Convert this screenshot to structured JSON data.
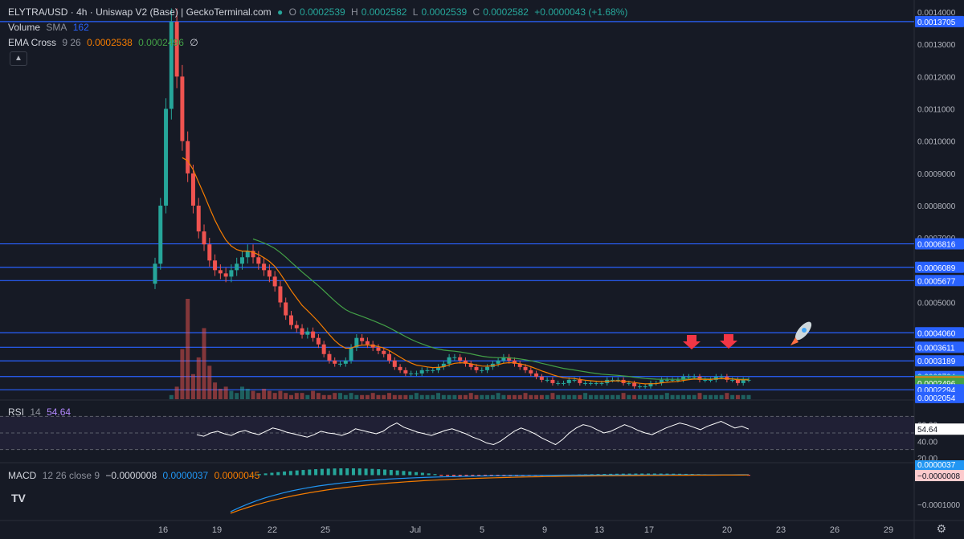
{
  "header": {
    "title": "ELYTRA/USD · 4h · Uniswap V2 (Base) | GeckoTerminal.com",
    "o_label": "O",
    "o_value": "0.0002539",
    "h_label": "H",
    "h_value": "0.0002582",
    "l_label": "L",
    "l_value": "0.0002539",
    "c_label": "C",
    "c_value": "0.0002582",
    "change": "+0.0000043 (+1.68%)"
  },
  "volume_legend": {
    "label": "Volume",
    "sma_label": "SMA",
    "sma_value": "162"
  },
  "ema_legend": {
    "label": "EMA Cross",
    "params": "9 26",
    "ema9": "0.0002538",
    "ema26": "0.0002496",
    "symbol": "∅"
  },
  "rsi_legend": {
    "label": "RSI",
    "param": "14",
    "value": "54.64"
  },
  "macd_legend": {
    "label": "MACD",
    "params": "12 26 close 9",
    "macd": "−0.0000008",
    "signal": "0.0000037",
    "hist": "0.0000045"
  },
  "colors": {
    "up": "#26a69a",
    "down": "#ef5350",
    "ema9": "#f57c00",
    "ema26": "#43a047",
    "hline": "#2962ff",
    "bg": "#161a25"
  },
  "chart_data": {
    "type": "candlestick",
    "title": "ELYTRA/USD · 4h · Uniswap V2 (Base)",
    "x_tick_labels": [
      "16",
      "19",
      "22",
      "25",
      "Jul",
      "5",
      "9",
      "13",
      "17",
      "20",
      "23",
      "26",
      "29"
    ],
    "price_ticks": [
      "0.0014000",
      "0.0013000",
      "0.0012000",
      "0.0011000",
      "0.0010000",
      "0.0009000",
      "0.0008000",
      "0.0007000",
      "0.0005000"
    ],
    "price_ylim": [
      0.0002,
      0.0014
    ],
    "horizontal_lines": [
      0.0013705,
      0.0006816,
      0.0006089,
      0.0005677,
      0.000406,
      0.0003611,
      0.0003189,
      0.0002704,
      0.0002294
    ],
    "price_labels": [
      {
        "text": "0.0013705",
        "value": 0.0013705,
        "color": "#2962ff"
      },
      {
        "text": "0.0006816",
        "value": 0.0006816,
        "color": "#2962ff"
      },
      {
        "text": "0.0006089",
        "value": 0.0006089,
        "color": "#2962ff"
      },
      {
        "text": "0.0005677",
        "value": 0.0005677,
        "color": "#2962ff"
      },
      {
        "text": "0.0004060",
        "value": 0.000406,
        "color": "#2962ff"
      },
      {
        "text": "0.0003611",
        "value": 0.0003611,
        "color": "#2962ff"
      },
      {
        "text": "0.0003189",
        "value": 0.0003189,
        "color": "#2962ff"
      },
      {
        "text": "0.0002704",
        "value": 0.0002704,
        "color": "#2962ff"
      },
      {
        "text": "0.0002582",
        "value": 0.0002582,
        "color": "#26a69a"
      },
      {
        "text": "0.0002538",
        "value": 0.0002538,
        "color": "#f57c00"
      },
      {
        "text": "0.0002496",
        "value": 0.0002496,
        "color": "#43a047"
      },
      {
        "text": "0.0002294",
        "value": 0.0002294,
        "color": "#2962ff"
      },
      {
        "text": "0.0002054",
        "value": 0.0002054,
        "color": "#2962ff"
      }
    ],
    "close_series": [
      0.00062,
      0.0008,
      0.0011,
      0.00137,
      0.0012,
      0.001,
      0.0009,
      0.0008,
      0.00072,
      0.00068,
      0.00063,
      0.0006,
      0.00059,
      0.00058,
      0.0006,
      0.00062,
      0.00064,
      0.00066,
      0.00064,
      0.00062,
      0.0006,
      0.00058,
      0.00055,
      0.0005,
      0.00046,
      0.00043,
      0.00042,
      0.0004,
      0.00041,
      0.00039,
      0.00037,
      0.00034,
      0.00032,
      0.00031,
      0.00031,
      0.00032,
      0.00036,
      0.00039,
      0.00038,
      0.00037,
      0.00036,
      0.00035,
      0.00034,
      0.00032,
      0.0003,
      0.00029,
      0.00028,
      0.00028,
      0.00028,
      0.00029,
      0.00029,
      0.00029,
      0.0003,
      0.00031,
      0.00033,
      0.00033,
      0.00032,
      0.00031,
      0.0003,
      0.00029,
      0.00029,
      0.0003,
      0.00031,
      0.00032,
      0.00033,
      0.00032,
      0.00031,
      0.0003,
      0.00029,
      0.00028,
      0.00027,
      0.00026,
      0.00026,
      0.00025,
      0.00025,
      0.00025,
      0.00026,
      0.00026,
      0.00025,
      0.00025,
      0.00025,
      0.00025,
      0.00025,
      0.00026,
      0.00026,
      0.00026,
      0.00025,
      0.00025,
      0.00024,
      0.00024,
      0.00024,
      0.00025,
      0.00025,
      0.00026,
      0.00026,
      0.00026,
      0.00026,
      0.00027,
      0.00027,
      0.00027,
      0.00026,
      0.00026,
      0.00026,
      0.00027,
      0.00027,
      0.00026,
      0.00026,
      0.00025,
      0.00026,
      0.00026
    ],
    "volume_series": [
      0,
      0,
      0,
      2,
      6,
      24,
      48,
      12,
      20,
      34,
      16,
      8,
      5,
      6,
      4,
      3,
      6,
      5,
      4,
      3,
      5,
      4,
      3,
      4,
      3,
      2,
      3,
      3,
      2,
      4,
      3,
      2,
      2,
      3,
      3,
      2,
      3,
      2,
      2,
      2,
      3,
      2,
      2,
      3,
      2,
      2,
      2,
      2,
      3,
      2,
      2,
      2,
      3,
      2,
      2,
      2,
      2,
      2,
      3,
      2,
      2,
      2,
      2,
      3,
      2,
      2,
      2,
      2,
      3,
      2,
      2,
      2,
      2,
      3,
      2,
      2,
      2,
      2,
      2,
      3,
      2,
      2,
      2,
      2,
      2,
      2,
      3,
      2,
      2,
      2,
      2,
      2,
      2,
      2,
      3,
      2,
      2,
      2,
      2,
      2,
      3,
      2,
      2,
      2,
      2,
      3,
      2,
      2,
      2,
      2
    ],
    "rsi_ticks": [
      "60.00",
      "40.00",
      "20.00"
    ],
    "rsi_series": [
      48,
      46,
      50,
      52,
      49,
      47,
      51,
      53,
      50,
      48,
      52,
      56,
      54,
      51,
      49,
      47,
      45,
      48,
      52,
      50,
      49,
      47,
      50,
      55,
      53,
      51,
      49,
      52,
      58,
      62,
      57,
      54,
      51,
      49,
      47,
      50,
      53,
      55,
      52,
      49,
      45,
      42,
      38,
      36,
      40,
      46,
      52,
      56,
      53,
      49,
      44,
      40,
      36,
      42,
      50,
      56,
      60,
      58,
      54,
      50,
      52,
      56,
      60,
      57,
      53,
      50,
      48,
      52,
      56,
      59,
      62,
      60,
      57,
      54,
      58,
      61,
      64,
      60,
      56,
      58,
      54.64
    ],
    "rsi_current": 54.64,
    "macd_ticks": [
      "−0.0001000"
    ],
    "macd_current_labels": [
      "0.0000037",
      "−0.0000008"
    ],
    "annotations": [
      "down-arrow-marker",
      "down-arrow-marker",
      "rocket"
    ]
  }
}
